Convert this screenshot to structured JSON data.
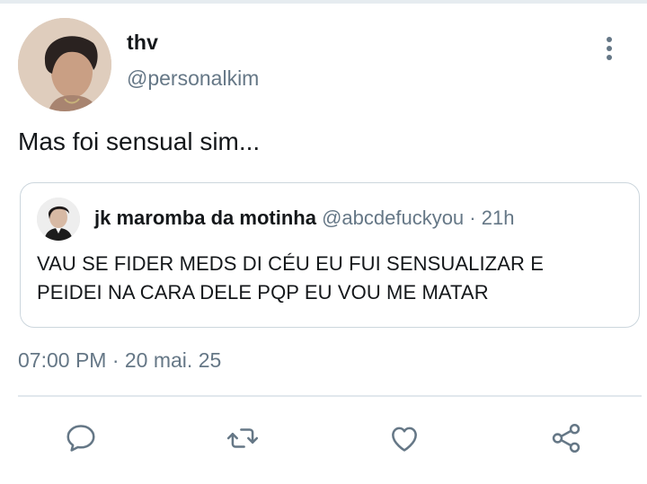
{
  "author": {
    "name": "thv",
    "handle": "@personalkim"
  },
  "tweet": {
    "text": "Mas foi sensual sim...",
    "timestamp": "07:00 PM · 20 mai. 25"
  },
  "quoted_tweet": {
    "name": "jk maromba da motinha",
    "handle": "@abcdefuckyou",
    "separator": "·",
    "time": "21h",
    "text": "VAU SE FIDER MEDS DI CÉU EU FUI SENSUALIZAR E PEIDEI NA CARA DELE PQP EU VOU ME MATAR"
  },
  "actions": [
    "reply-icon",
    "retweet-icon",
    "like-icon",
    "share-icon"
  ],
  "colors": {
    "text_primary": "#14171a",
    "text_secondary": "#657786",
    "border": "#ccd6dd"
  }
}
